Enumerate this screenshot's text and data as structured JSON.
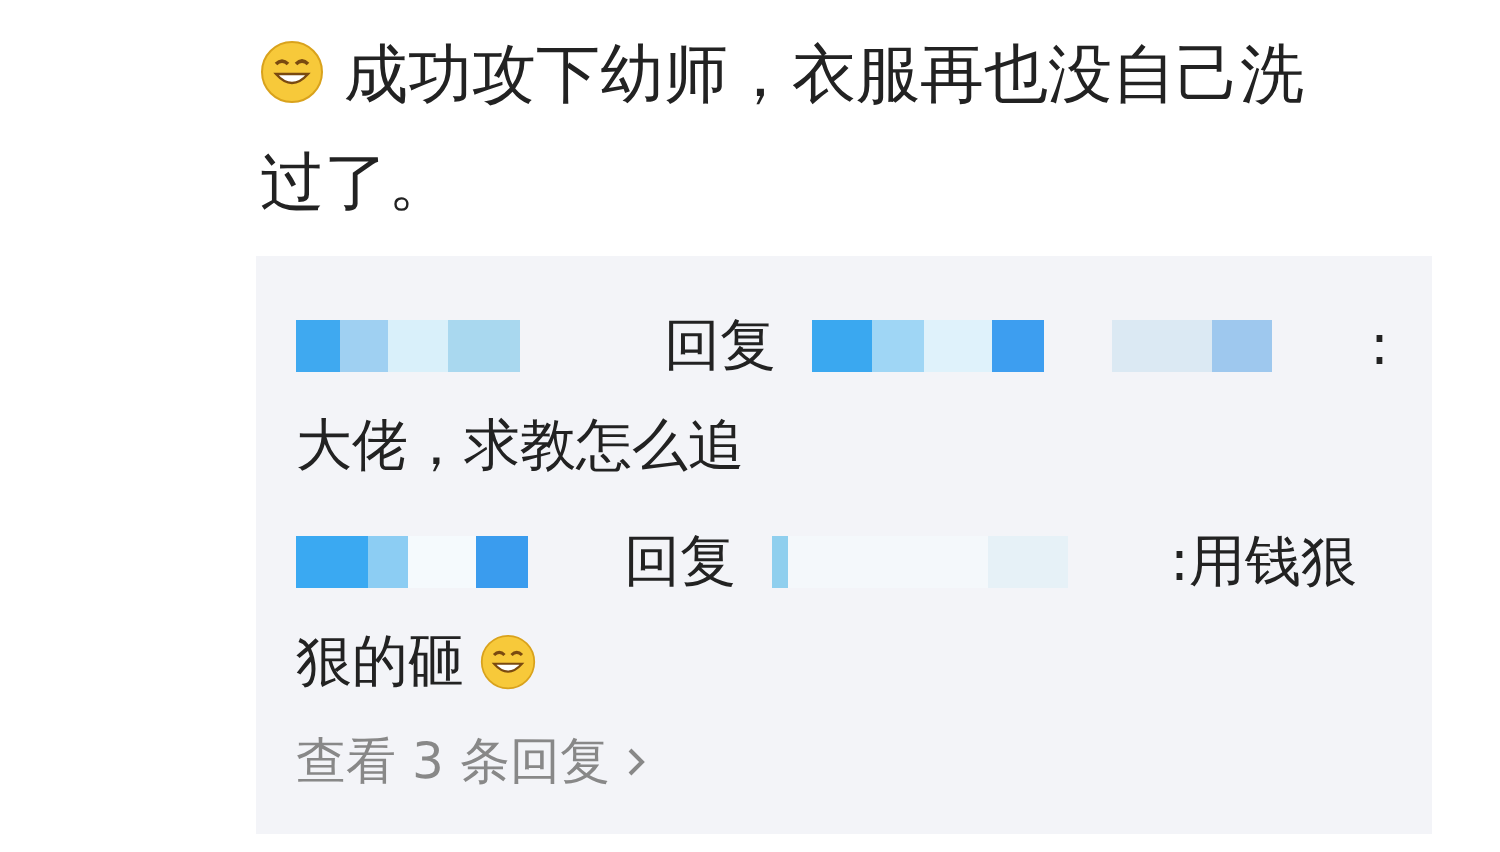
{
  "post": {
    "text": "成功攻下幼师，衣服再也没自己洗过了。",
    "emoji": true
  },
  "replies": [
    {
      "verb": "回复",
      "lines": [
        ":",
        "大佬，求教怎么追"
      ],
      "emoji": false
    },
    {
      "verb": "回复",
      "lines": [
        ":用钱狠",
        "狠的砸"
      ],
      "emoji": true
    }
  ],
  "more_link": "查看 3 条回复"
}
